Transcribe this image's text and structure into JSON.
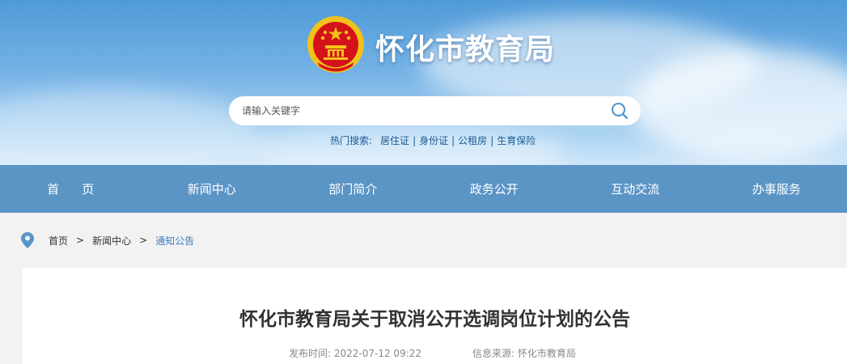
{
  "header": {
    "site_title": "怀化市教育局"
  },
  "search": {
    "placeholder": "请输入关键字",
    "hot_label": "热门搜索:",
    "hot_links": [
      "居住证",
      "身份证",
      "公租房",
      "生育保险"
    ]
  },
  "nav": {
    "items": [
      "首页",
      "新闻中心",
      "部门简介",
      "政务公开",
      "互动交流",
      "办事服务"
    ]
  },
  "breadcrumb": {
    "items": [
      "首页",
      "新闻中心",
      "通知公告"
    ],
    "separator": ">"
  },
  "article": {
    "title": "怀化市教育局关于取消公开选调岗位计划的公告",
    "publish_label": "发布时间:",
    "publish_time": "2022-07-12 09:22",
    "source_label": "信息来源:",
    "source": "怀化市教育局"
  },
  "colors": {
    "nav_bg": "#5b95c6",
    "accent": "#3a7fc0",
    "emblem_red": "#d4121a",
    "emblem_gold": "#f2c21a"
  }
}
